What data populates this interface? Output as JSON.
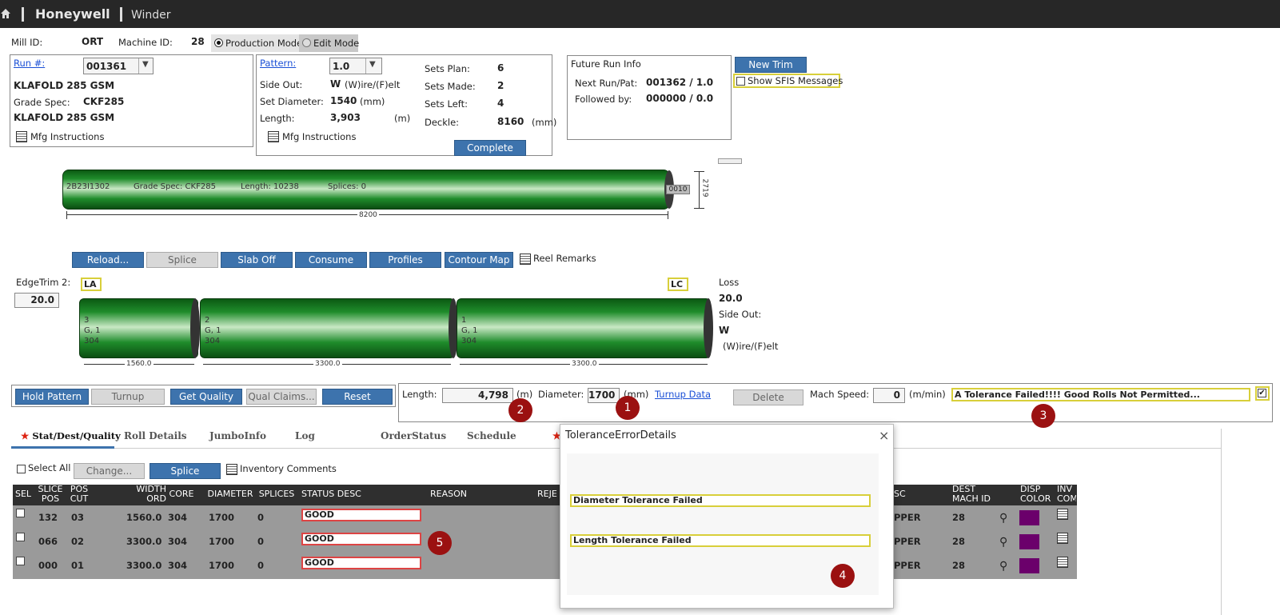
{
  "topbar": {
    "brand": "Honeywell",
    "app": "Winder"
  },
  "header": {
    "mill_label": "Mill ID:",
    "mill_value": "ORT",
    "machine_label": "Machine ID:",
    "machine_value": "28",
    "production_mode": "Production Mode",
    "edit_mode": "Edit Mode"
  },
  "run_panel": {
    "run_label": "Run #:",
    "run_value": "001361",
    "grade_name_1": "KLAFOLD 285 GSM",
    "grade_spec_label": "Grade Spec:",
    "grade_spec_value": "CKF285",
    "grade_name_2": "KLAFOLD 285 GSM",
    "mfg_instructions": "Mfg Instructions"
  },
  "pattern_panel": {
    "pattern_label": "Pattern:",
    "pattern_value": "1.0",
    "side_out_label": "Side Out:",
    "side_out_value": "W",
    "side_out_hint": "(W)ire/(F)elt",
    "set_diameter_label": "Set Diameter:",
    "set_diameter_value": "1540",
    "set_diameter_unit": "(mm)",
    "length_label": "Length:",
    "length_value": "3,903",
    "length_unit": "(m)",
    "sets_plan_label": "Sets Plan:",
    "sets_plan_value": "6",
    "sets_made_label": "Sets Made:",
    "sets_made_value": "2",
    "sets_left_label": "Sets Left:",
    "sets_left_value": "4",
    "deckle_label": "Deckle:",
    "deckle_value": "8160",
    "deckle_unit": "(mm)",
    "mfg_instructions": "Mfg Instructions",
    "complete_button": "Complete"
  },
  "future_panel": {
    "title": "Future Run Info",
    "next_label": "Next Run/Pat:",
    "next_value": "001362 / 1.0",
    "followed_label": "Followed by:",
    "followed_value": "000000 / 0.0"
  },
  "new_trim_button": "New Trim",
  "show_sfis": "Show SFIS Messages",
  "reel": {
    "id": "2B23I1302",
    "grade_spec": "Grade Spec: CKF285",
    "length": "Length: 10238",
    "splices": "Splices: 0",
    "core": "0010",
    "width_dim": "8200",
    "height_dim": "2719"
  },
  "reel_buttons": [
    "Reload...",
    "Splice",
    "Slab Off",
    "Consume",
    "Profiles",
    "Contour Map"
  ],
  "reel_remarks": "Reel Remarks",
  "edge": {
    "label": "EdgeTrim 2:",
    "value": "20.0",
    "la": "LA",
    "lc": "LC"
  },
  "loss": {
    "label": "Loss",
    "value": "20.0",
    "side_out_label": "Side Out:",
    "side_out_value": "W",
    "side_out_hint": "(W)ire/(F)elt"
  },
  "sets": [
    {
      "num": "3",
      "grade": "G, 1",
      "core": "304",
      "width": "1560.0"
    },
    {
      "num": "2",
      "grade": "G, 1",
      "core": "304",
      "width": "3300.0"
    },
    {
      "num": "1",
      "grade": "G, 1",
      "core": "304",
      "width": "3300.0"
    }
  ],
  "action_buttons": [
    "Hold Pattern",
    "Turnup",
    "Get Quality",
    "Qual Claims...",
    "Reset"
  ],
  "measure": {
    "length_label": "Length:",
    "length_value": "4,798",
    "length_unit": "(m)",
    "diameter_label": "Diameter:",
    "diameter_value": "1700",
    "diameter_unit": "(mm)",
    "turnup_link": "Turnup Data",
    "delete_button": "Delete",
    "speed_label": "Mach Speed:",
    "speed_value": "0",
    "speed_unit": "(m/min)",
    "tolerance_msg": "A Tolerance Failed!!!! Good Rolls Not Permitted..."
  },
  "tabs": [
    "Stat/Dest/Quality",
    "Roll Details",
    "JumboInfo",
    "Log",
    "OrderStatus",
    "Schedule"
  ],
  "grid_toolbar": {
    "select_all": "Select All",
    "change_button": "Change...",
    "splice_button": "Splice",
    "inventory_comments": "Inventory Comments"
  },
  "grid_headers": {
    "sel": "SEL",
    "slice_pos": "SLICE POS",
    "pos_cut": "POS CUT",
    "width_ord": "WIDTH ORD",
    "core": "CORE",
    "diameter": "DIAMETER",
    "splices": "SPLICES",
    "status_desc": "STATUS DESC",
    "reason": "REASON",
    "reje": "REJE",
    "desc": "SC",
    "dest_mach_id": "DEST MACH ID",
    "disp_color": "DISP COLOR",
    "inv_com": "INV COM"
  },
  "grid_rows": [
    {
      "slice": "132",
      "cut": "03",
      "width": "1560.0",
      "core": "304",
      "diameter": "1700",
      "splices": "0",
      "status": "GOOD",
      "desc": "PPER",
      "dest": "28"
    },
    {
      "slice": "066",
      "cut": "02",
      "width": "3300.0",
      "core": "304",
      "diameter": "1700",
      "splices": "0",
      "status": "GOOD",
      "desc": "PPER",
      "dest": "28"
    },
    {
      "slice": "000",
      "cut": "01",
      "width": "3300.0",
      "core": "304",
      "diameter": "1700",
      "splices": "0",
      "status": "GOOD",
      "desc": "PPER",
      "dest": "28"
    }
  ],
  "dialog": {
    "title": "ToleranceErrorDetails",
    "close": "×",
    "messages": [
      "Diameter Tolerance Failed",
      "Length Tolerance Failed"
    ]
  },
  "markers": [
    "1",
    "2",
    "3",
    "4",
    "5"
  ],
  "colors": {
    "accent_blue": "#3d73ad",
    "roll_green": "#1f8c2b",
    "marker_red": "#9b1111",
    "highlight_yellow": "#d8cf3a",
    "disp_purple": "#6b006b"
  }
}
